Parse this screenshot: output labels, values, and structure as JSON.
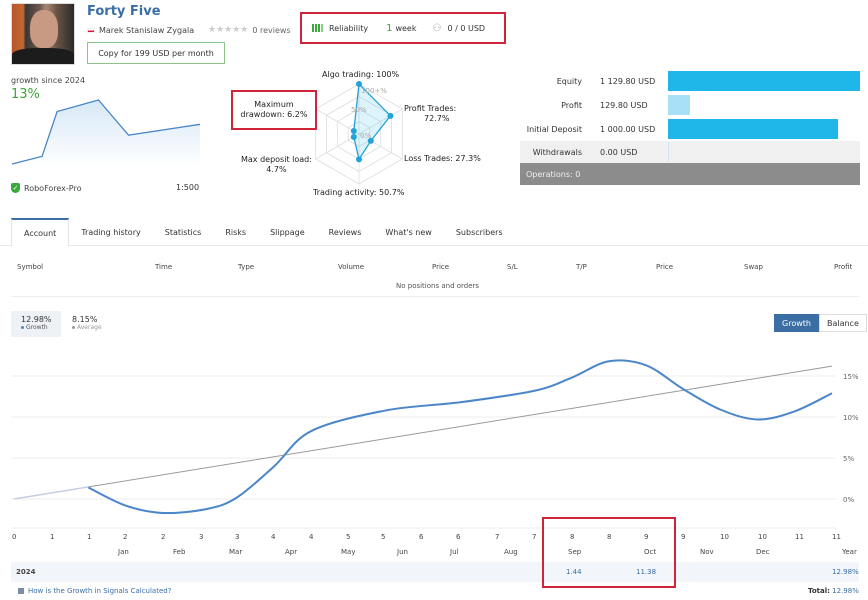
{
  "header": {
    "title": "Forty Five",
    "author": "Marek Stanislaw Zygala",
    "reviews": "0 reviews",
    "copy_button": "Copy for 199 USD per month",
    "reliability_label": "Reliability",
    "age_value": "1",
    "age_unit": "week",
    "subscribers_funds": "0 / 0 USD"
  },
  "summary": {
    "growth_label": "growth since 2024",
    "growth_value": "13%",
    "broker": "RoboForex-Pro",
    "leverage": "1:500",
    "mini_chart_points": [
      0,
      0.12,
      0.82,
      1.0,
      0.45,
      0.62
    ]
  },
  "radar": {
    "labels": {
      "algo": "Algo trading: 100%",
      "profit": "Profit Trades:",
      "profit_val": "72.7%",
      "loss": "Loss Trades: 27.3%",
      "activity": "Trading activity: 50.7%",
      "load": "Max deposit load:",
      "load_val": "4.7%",
      "dd": "Maximum",
      "dd_val": "drawdown: 6.2%"
    },
    "ticks": [
      "100+%",
      "50%",
      "0%"
    ],
    "values": [
      100,
      72.7,
      27.3,
      50.7,
      4.7,
      6.2
    ]
  },
  "equity": {
    "rows": [
      {
        "label": "Equity",
        "value": "1 129.80 USD",
        "fraction": 1.0
      },
      {
        "label": "Profit",
        "value": "129.80 USD",
        "fraction": 0.115
      },
      {
        "label": "Initial Deposit",
        "value": "1 000.00 USD",
        "fraction": 0.885
      },
      {
        "label": "Withdrawals",
        "value": "0.00 USD",
        "fraction": 0
      }
    ],
    "operations": "Operations: 0"
  },
  "tabs": [
    "Account",
    "Trading history",
    "Statistics",
    "Risks",
    "Slippage",
    "Reviews",
    "What's new",
    "Subscribers"
  ],
  "positions": {
    "columns": [
      "Symbol",
      "Time",
      "Type",
      "Volume",
      "Price",
      "S/L",
      "T/P",
      "Price",
      "Swap",
      "Profit"
    ],
    "empty": "No positions and orders"
  },
  "growth_panel": {
    "growth_value": "12.98%",
    "growth_label": "Growth",
    "average_value": "8.15%",
    "average_label": "Average",
    "toggle": [
      "Growth",
      "Balance"
    ],
    "colors": {
      "growth": "#4a86c8",
      "average": "#999999",
      "accent": "#3a6ea5"
    }
  },
  "chart_data": {
    "type": "line",
    "x_ticks": [
      "0",
      "1",
      "1",
      "2",
      "2",
      "3",
      "3",
      "4",
      "4",
      "5",
      "5",
      "6",
      "6",
      "7",
      "7",
      "8",
      "8",
      "9",
      "9",
      "10",
      "10",
      "11",
      "11"
    ],
    "months": [
      "Jan",
      "Feb",
      "Mar",
      "Apr",
      "May",
      "Jun",
      "Jul",
      "Aug",
      "Sep",
      "Oct",
      "Nov",
      "Dec",
      "Year"
    ],
    "y_ticks": [
      "0%",
      "5%",
      "10%",
      "15%"
    ],
    "ylim": [
      -4,
      17
    ],
    "xlim": [
      0,
      11
    ],
    "series": [
      {
        "name": "Growth",
        "x": [
          1.0,
          1.5,
          2.0,
          2.6,
          3.0,
          3.5,
          4.0,
          5.0,
          6.0,
          7.0,
          7.5,
          8.0,
          8.5,
          9.0,
          9.5,
          10.0,
          10.5,
          11.0
        ],
        "y": [
          1.4,
          -0.8,
          -1.7,
          -1.2,
          0.2,
          4.0,
          8.3,
          10.8,
          11.8,
          13.2,
          14.8,
          16.8,
          16.3,
          13.4,
          10.9,
          9.7,
          10.7,
          12.9
        ]
      },
      {
        "name": "Average",
        "x": [
          0,
          11
        ],
        "y": [
          0,
          16.2
        ]
      }
    ],
    "grid": true,
    "legend": "top-left"
  },
  "monthly": {
    "year": "2024",
    "values": {
      "Sep": "1.44",
      "Oct": "11.38",
      "Year": "12.98%"
    },
    "help_link": "How is the Growth in Signals Calculated?",
    "total_label": "Total:",
    "total_value": "12.98%"
  }
}
